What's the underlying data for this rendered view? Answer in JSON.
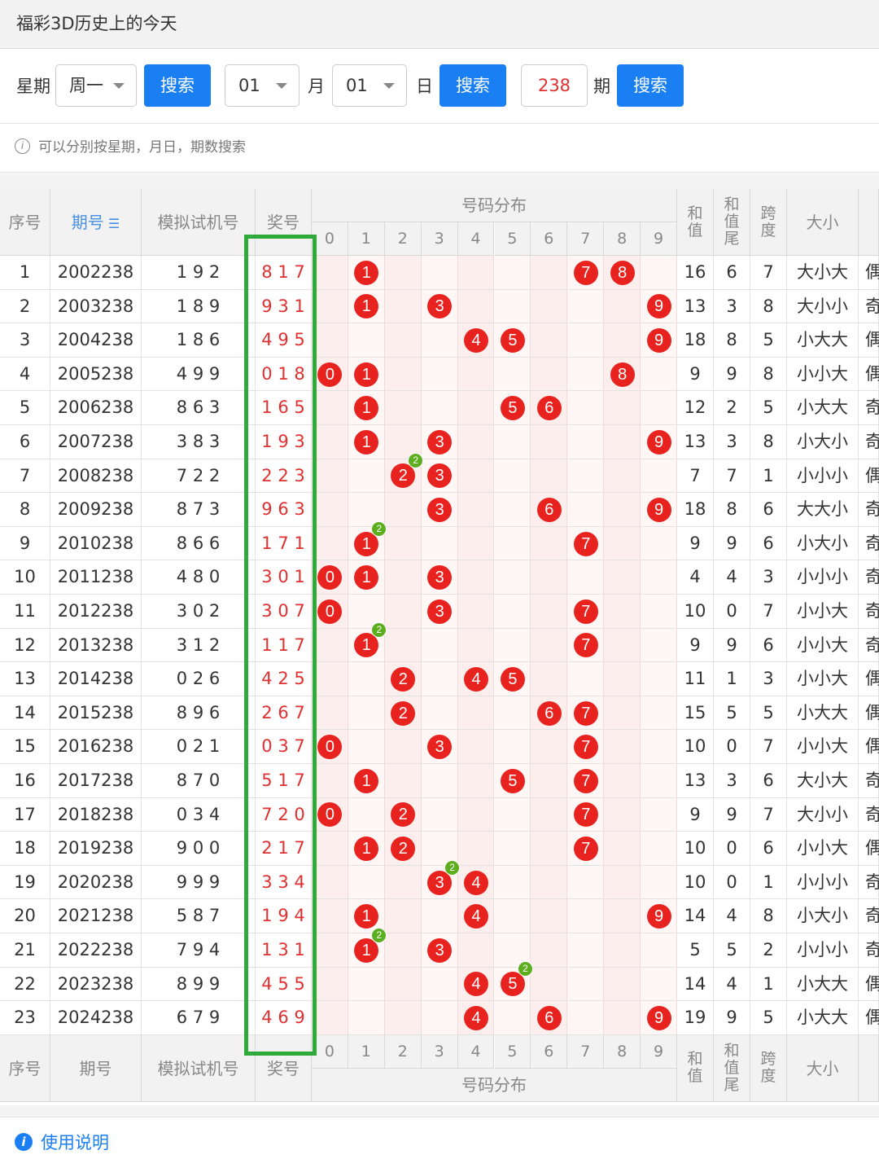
{
  "title": "福彩3D历史上的今天",
  "search": {
    "weekday_label": "星期",
    "weekday_value": "周一",
    "search_btn": "搜索",
    "month_value": "01",
    "month_label": "月",
    "day_value": "01",
    "day_label": "日",
    "issue_value": "238",
    "issue_label": "期"
  },
  "hint": "可以分别按星期，月日，期数搜索",
  "table": {
    "headers": {
      "seq": "序号",
      "issue": "期号",
      "sim": "模拟试机号",
      "prize": "奖号",
      "dist": "号码分布",
      "sum": "和值",
      "sum_tail": "和值尾",
      "span": "跨度",
      "size": "大小"
    },
    "digits": [
      "0",
      "1",
      "2",
      "3",
      "4",
      "5",
      "6",
      "7",
      "8",
      "9"
    ],
    "rows": [
      {
        "seq": "1",
        "issue": "2002238",
        "sim": "1 9 2",
        "prize": "8 1 7",
        "sum": "16",
        "tail": "6",
        "span": "7",
        "size": "大小大",
        "parity": "偶",
        "d": [
          8,
          1,
          7
        ]
      },
      {
        "seq": "2",
        "issue": "2003238",
        "sim": "1 8 9",
        "prize": "9 3 1",
        "sum": "13",
        "tail": "3",
        "span": "8",
        "size": "大小小",
        "parity": "奇",
        "d": [
          9,
          3,
          1
        ]
      },
      {
        "seq": "3",
        "issue": "2004238",
        "sim": "1 8 6",
        "prize": "4 9 5",
        "sum": "18",
        "tail": "8",
        "span": "5",
        "size": "小大大",
        "parity": "偶",
        "d": [
          4,
          9,
          5
        ]
      },
      {
        "seq": "4",
        "issue": "2005238",
        "sim": "4 9 9",
        "prize": "0 1 8",
        "sum": "9",
        "tail": "9",
        "span": "8",
        "size": "小小大",
        "parity": "偶",
        "d": [
          0,
          1,
          8
        ]
      },
      {
        "seq": "5",
        "issue": "2006238",
        "sim": "8 6 3",
        "prize": "1 6 5",
        "sum": "12",
        "tail": "2",
        "span": "5",
        "size": "小大大",
        "parity": "奇",
        "d": [
          1,
          6,
          5
        ]
      },
      {
        "seq": "6",
        "issue": "2007238",
        "sim": "3 8 3",
        "prize": "1 9 3",
        "sum": "13",
        "tail": "3",
        "span": "8",
        "size": "小大小",
        "parity": "奇",
        "d": [
          1,
          9,
          3
        ]
      },
      {
        "seq": "7",
        "issue": "2008238",
        "sim": "7 2 2",
        "prize": "2 2 3",
        "sum": "7",
        "tail": "7",
        "span": "1",
        "size": "小小小",
        "parity": "偶",
        "d": [
          2,
          2,
          3
        ]
      },
      {
        "seq": "8",
        "issue": "2009238",
        "sim": "8 7 3",
        "prize": "9 6 3",
        "sum": "18",
        "tail": "8",
        "span": "6",
        "size": "大大小",
        "parity": "奇",
        "d": [
          9,
          6,
          3
        ]
      },
      {
        "seq": "9",
        "issue": "2010238",
        "sim": "8 6 6",
        "prize": "1 7 1",
        "sum": "9",
        "tail": "9",
        "span": "6",
        "size": "小大小",
        "parity": "奇",
        "d": [
          1,
          7,
          1
        ]
      },
      {
        "seq": "10",
        "issue": "2011238",
        "sim": "4 8 0",
        "prize": "3 0 1",
        "sum": "4",
        "tail": "4",
        "span": "3",
        "size": "小小小",
        "parity": "奇",
        "d": [
          3,
          0,
          1
        ]
      },
      {
        "seq": "11",
        "issue": "2012238",
        "sim": "3 0 2",
        "prize": "3 0 7",
        "sum": "10",
        "tail": "0",
        "span": "7",
        "size": "小小大",
        "parity": "奇",
        "d": [
          3,
          0,
          7
        ]
      },
      {
        "seq": "12",
        "issue": "2013238",
        "sim": "3 1 2",
        "prize": "1 1 7",
        "sum": "9",
        "tail": "9",
        "span": "6",
        "size": "小小大",
        "parity": "奇",
        "d": [
          1,
          1,
          7
        ]
      },
      {
        "seq": "13",
        "issue": "2014238",
        "sim": "0 2 6",
        "prize": "4 2 5",
        "sum": "11",
        "tail": "1",
        "span": "3",
        "size": "小小大",
        "parity": "偶",
        "d": [
          4,
          2,
          5
        ]
      },
      {
        "seq": "14",
        "issue": "2015238",
        "sim": "8 9 6",
        "prize": "2 6 7",
        "sum": "15",
        "tail": "5",
        "span": "5",
        "size": "小大大",
        "parity": "偶",
        "d": [
          2,
          6,
          7
        ]
      },
      {
        "seq": "15",
        "issue": "2016238",
        "sim": "0 2 1",
        "prize": "0 3 7",
        "sum": "10",
        "tail": "0",
        "span": "7",
        "size": "小小大",
        "parity": "偶",
        "d": [
          0,
          3,
          7
        ]
      },
      {
        "seq": "16",
        "issue": "2017238",
        "sim": "8 7 0",
        "prize": "5 1 7",
        "sum": "13",
        "tail": "3",
        "span": "6",
        "size": "大小大",
        "parity": "奇",
        "d": [
          5,
          1,
          7
        ]
      },
      {
        "seq": "17",
        "issue": "2018238",
        "sim": "0 3 4",
        "prize": "7 2 0",
        "sum": "9",
        "tail": "9",
        "span": "7",
        "size": "大小小",
        "parity": "奇",
        "d": [
          7,
          2,
          0
        ]
      },
      {
        "seq": "18",
        "issue": "2019238",
        "sim": "9 0 0",
        "prize": "2 1 7",
        "sum": "10",
        "tail": "0",
        "span": "6",
        "size": "小小大",
        "parity": "偶",
        "d": [
          2,
          1,
          7
        ]
      },
      {
        "seq": "19",
        "issue": "2020238",
        "sim": "9 9 9",
        "prize": "3 3 4",
        "sum": "10",
        "tail": "0",
        "span": "1",
        "size": "小小小",
        "parity": "奇",
        "d": [
          3,
          3,
          4
        ]
      },
      {
        "seq": "20",
        "issue": "2021238",
        "sim": "5 8 7",
        "prize": "1 9 4",
        "sum": "14",
        "tail": "4",
        "span": "8",
        "size": "小大小",
        "parity": "奇",
        "d": [
          1,
          9,
          4
        ]
      },
      {
        "seq": "21",
        "issue": "2022238",
        "sim": "7 9 4",
        "prize": "1 3 1",
        "sum": "5",
        "tail": "5",
        "span": "2",
        "size": "小小小",
        "parity": "奇",
        "d": [
          1,
          3,
          1
        ]
      },
      {
        "seq": "22",
        "issue": "2023238",
        "sim": "8 9 9",
        "prize": "4 5 5",
        "sum": "14",
        "tail": "4",
        "span": "1",
        "size": "小大大",
        "parity": "偶",
        "d": [
          4,
          5,
          5
        ]
      },
      {
        "seq": "23",
        "issue": "2024238",
        "sim": "6 7 9",
        "prize": "4 6 9",
        "sum": "19",
        "tail": "9",
        "span": "5",
        "size": "小大大",
        "parity": "偶",
        "d": [
          4,
          6,
          9
        ]
      }
    ]
  },
  "footer": "使用说明",
  "colors": {
    "ball": "#e8231f",
    "repeat_badge": "#5cae1f",
    "button": "#1a7ff3",
    "highlight_box": "#2eaa3a",
    "prize_text": "#e03030"
  }
}
